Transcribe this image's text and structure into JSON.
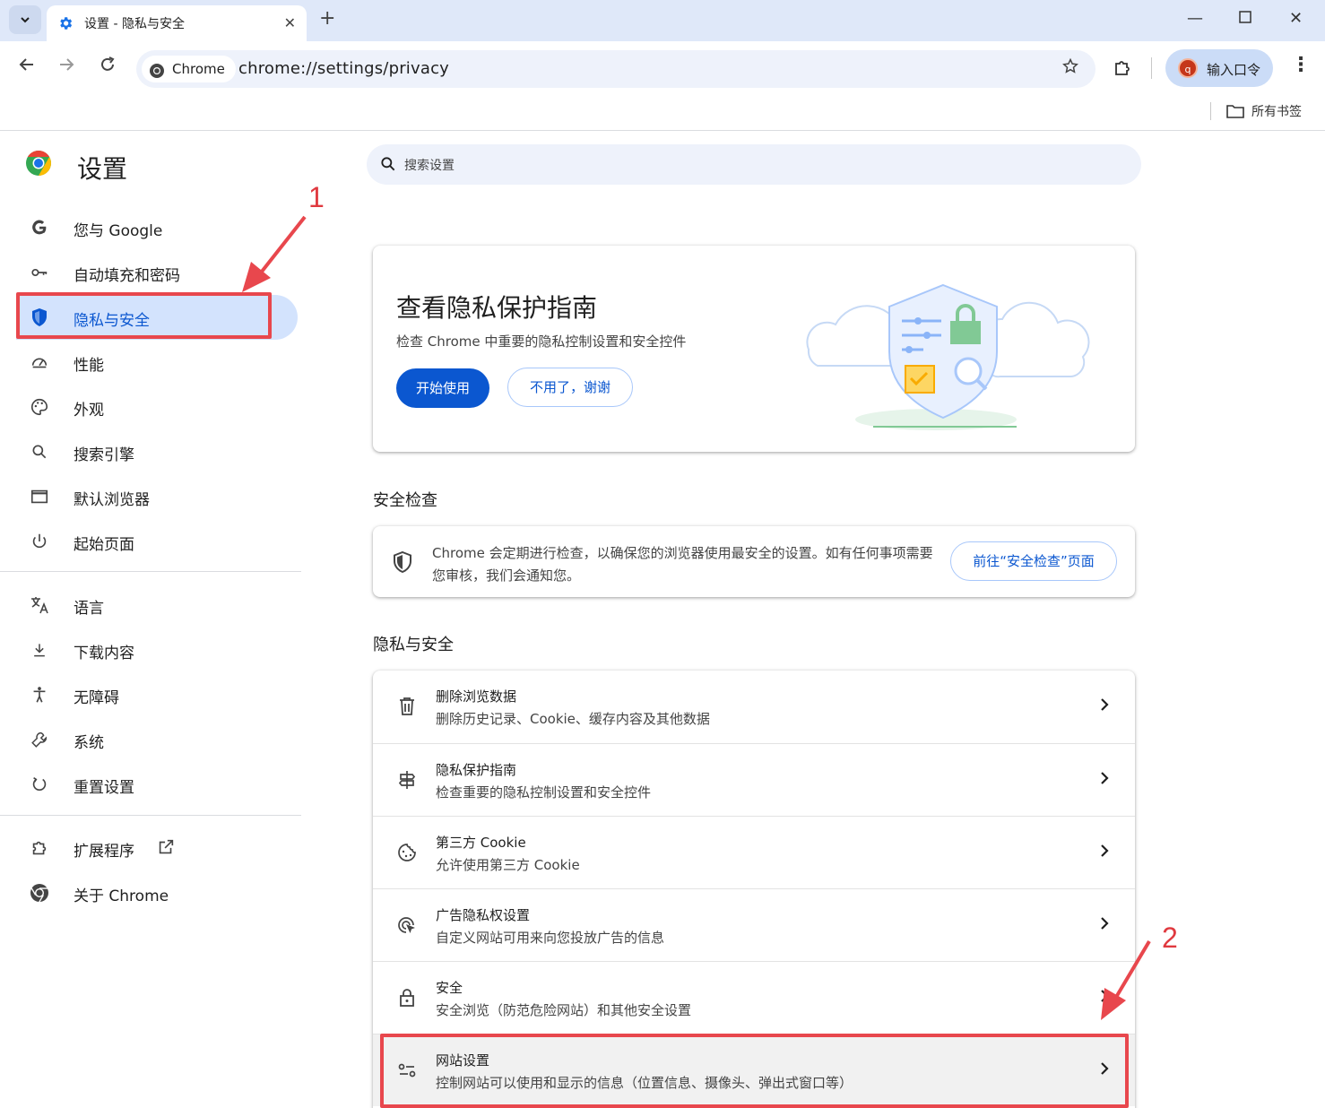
{
  "browser": {
    "tab_title": "设置 - 隐私与安全",
    "omnibox_chip": "Chrome",
    "url": "chrome://settings/privacy",
    "profile_label": "输入口令",
    "profile_initial": "q",
    "bookmarks_folder": "所有书签"
  },
  "sidebar": {
    "title": "设置",
    "items": [
      {
        "label": "您与 Google",
        "icon": "google-g-icon"
      },
      {
        "label": "自动填充和密码",
        "icon": "key-icon"
      },
      {
        "label": "隐私与安全",
        "icon": "shield-icon",
        "active": true
      },
      {
        "label": "性能",
        "icon": "speedometer-icon"
      },
      {
        "label": "外观",
        "icon": "palette-icon"
      },
      {
        "label": "搜索引擎",
        "icon": "search-icon"
      },
      {
        "label": "默认浏览器",
        "icon": "browser-window-icon"
      },
      {
        "label": "起始页面",
        "icon": "power-icon"
      },
      {
        "label": "语言",
        "icon": "translate-icon"
      },
      {
        "label": "下载内容",
        "icon": "download-icon"
      },
      {
        "label": "无障碍",
        "icon": "accessibility-icon"
      },
      {
        "label": "系统",
        "icon": "wrench-icon"
      },
      {
        "label": "重置设置",
        "icon": "reset-icon"
      },
      {
        "label": "扩展程序",
        "icon": "puzzle-icon"
      },
      {
        "label": "关于 Chrome",
        "icon": "chrome-icon"
      }
    ]
  },
  "search": {
    "placeholder": "搜索设置"
  },
  "promo": {
    "title": "查看隐私保护指南",
    "description": "检查 Chrome 中重要的隐私控制设置和安全控件",
    "primary_button": "开始使用",
    "secondary_button": "不用了，谢谢"
  },
  "safety_check": {
    "section_title": "安全检查",
    "text": "Chrome 会定期进行检查，以确保您的浏览器使用最安全的设置。如有任何事项需要您审核，我们会通知您。",
    "button": "前往“安全检查”页面"
  },
  "privacy": {
    "section_title": "隐私与安全",
    "rows": [
      {
        "title": "删除浏览数据",
        "subtitle": "删除历史记录、Cookie、缓存内容及其他数据",
        "icon": "trash-icon"
      },
      {
        "title": "隐私保护指南",
        "subtitle": "检查重要的隐私控制设置和安全控件",
        "icon": "signpost-icon"
      },
      {
        "title": "第三方 Cookie",
        "subtitle": "允许使用第三方 Cookie",
        "icon": "cookie-icon"
      },
      {
        "title": "广告隐私权设置",
        "subtitle": "自定义网站可用来向您投放广告的信息",
        "icon": "ad-privacy-icon"
      },
      {
        "title": "安全",
        "subtitle": "安全浏览（防范危险网站）和其他安全设置",
        "icon": "lock-icon"
      },
      {
        "title": "网站设置",
        "subtitle": "控制网站可以使用和显示的信息（位置信息、摄像头、弹出式窗口等）",
        "icon": "tune-icon"
      }
    ]
  },
  "annotations": {
    "first": "1",
    "second": "2",
    "color": "#e8474d"
  },
  "colors": {
    "accent": "#0b57d0",
    "active_bg": "#d3e3fd",
    "titlebar": "#dfe8f9"
  }
}
